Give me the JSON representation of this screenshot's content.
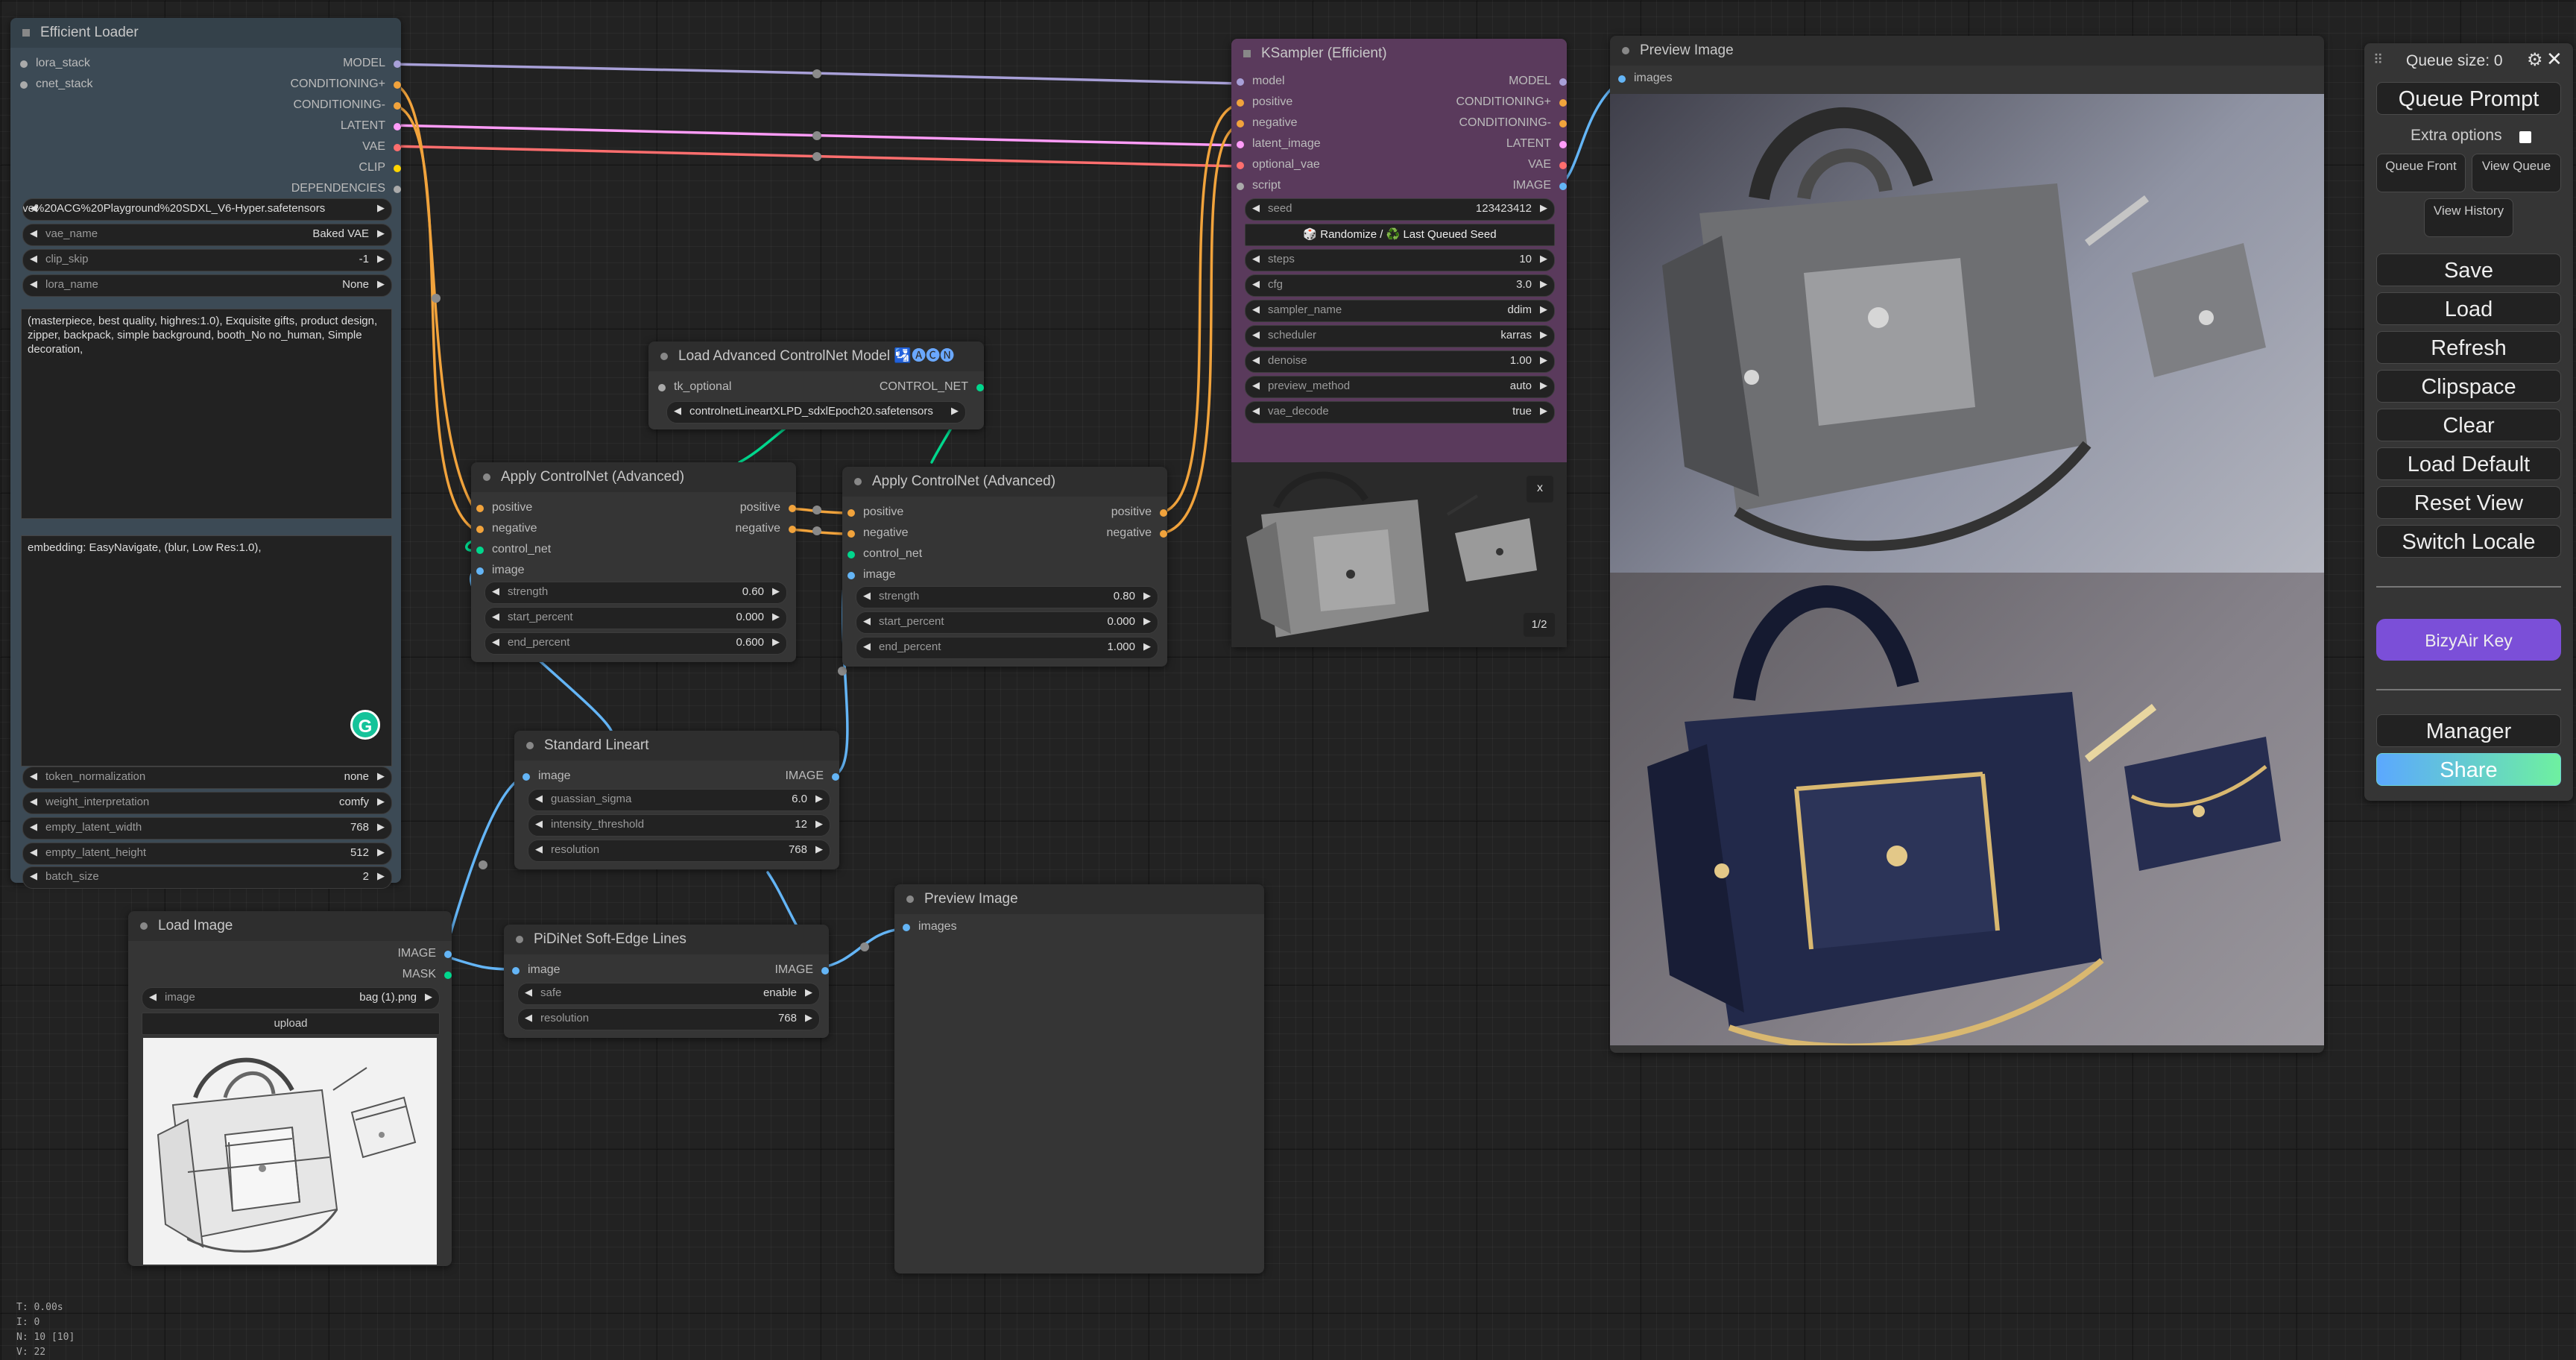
{
  "colors": {
    "model": "#a8a0d8",
    "conditioning": "#f1a33c",
    "latent": "#ff9cf9",
    "vae": "#ff6e6e",
    "clip": "#ffd500",
    "image": "#64b5f6",
    "control_net": "#00d78d",
    "default": "#aaaaaa",
    "purple_node": "#5a3a5c",
    "efficient_loader": "#3c4a55",
    "accent": "#7b4fd8"
  },
  "efficient_loader": {
    "title": "Efficient Loader",
    "inputs": [
      "lora_stack",
      "cnet_stack"
    ],
    "outputs": [
      "MODEL",
      "CONDITIONING+",
      "CONDITIONING-",
      "LATENT",
      "VAE",
      "CLIP",
      "DEPENDENCIES"
    ],
    "ckpt_name": "usive%20ACG%20Playground%20SDXL_V6-Hyper.safetensors",
    "widgets1": [
      {
        "label": "vae_name",
        "value": "Baked VAE"
      },
      {
        "label": "clip_skip",
        "value": "-1"
      },
      {
        "label": "lora_name",
        "value": "None"
      }
    ],
    "positive_prompt": "(masterpiece, best quality, highres:1.0), Exquisite gifts, product design, zipper, backpack, simple background, booth_No no_human, Simple decoration,",
    "negative_prompt": "embedding: EasyNavigate, (blur, Low Res:1.0),",
    "widgets2": [
      {
        "label": "token_normalization",
        "value": "none"
      },
      {
        "label": "weight_interpretation",
        "value": "comfy"
      },
      {
        "label": "empty_latent_width",
        "value": "768"
      },
      {
        "label": "empty_latent_height",
        "value": "512"
      },
      {
        "label": "batch_size",
        "value": "2"
      }
    ]
  },
  "ksampler": {
    "title": "KSampler (Efficient)",
    "inputs": [
      "model",
      "positive",
      "negative",
      "latent_image",
      "optional_vae",
      "script"
    ],
    "outputs": [
      "MODEL",
      "CONDITIONING+",
      "CONDITIONING-",
      "LATENT",
      "VAE",
      "IMAGE"
    ],
    "seed_label": "seed",
    "seed_value": "123423412",
    "randomize_button": "🎲 Randomize / ♻️ Last Queued Seed",
    "widgets": [
      {
        "label": "steps",
        "value": "10"
      },
      {
        "label": "cfg",
        "value": "3.0"
      },
      {
        "label": "sampler_name",
        "value": "ddim"
      },
      {
        "label": "scheduler",
        "value": "karras"
      },
      {
        "label": "denoise",
        "value": "1.00"
      },
      {
        "label": "preview_method",
        "value": "auto"
      },
      {
        "label": "vae_decode",
        "value": "true"
      }
    ],
    "preview_counter": "1/2",
    "preview_close": "x"
  },
  "preview_image_1": {
    "title": "Preview Image",
    "input": "images"
  },
  "preview_image_2": {
    "title": "Preview Image",
    "input": "images"
  },
  "controlnet_loader": {
    "title": "Load Advanced ControlNet Model",
    "badge": "🛂🅐🅒🅝",
    "input": "tk_optional",
    "output": "CONTROL_NET",
    "model_name": "controlnetLineartXLPD_sdxlEpoch20.safetensors"
  },
  "apply_cn_1": {
    "title": "Apply ControlNet (Advanced)",
    "inputs": [
      "positive",
      "negative",
      "control_net",
      "image"
    ],
    "outputs": [
      "positive",
      "negative"
    ],
    "widgets": [
      {
        "label": "strength",
        "value": "0.60"
      },
      {
        "label": "start_percent",
        "value": "0.000"
      },
      {
        "label": "end_percent",
        "value": "0.600"
      }
    ]
  },
  "apply_cn_2": {
    "title": "Apply ControlNet (Advanced)",
    "inputs": [
      "positive",
      "negative",
      "control_net",
      "image"
    ],
    "outputs": [
      "positive",
      "negative"
    ],
    "widgets": [
      {
        "label": "strength",
        "value": "0.80"
      },
      {
        "label": "start_percent",
        "value": "0.000"
      },
      {
        "label": "end_percent",
        "value": "1.000"
      }
    ]
  },
  "standard_lineart": {
    "title": "Standard Lineart",
    "input": "image",
    "output": "IMAGE",
    "widgets": [
      {
        "label": "guassian_sigma",
        "value": "6.0"
      },
      {
        "label": "intensity_threshold",
        "value": "12"
      },
      {
        "label": "resolution",
        "value": "768"
      }
    ]
  },
  "pidinet": {
    "title": "PiDiNet Soft-Edge Lines",
    "input": "image",
    "output": "IMAGE",
    "widgets": [
      {
        "label": "safe",
        "value": "enable"
      },
      {
        "label": "resolution",
        "value": "768"
      }
    ]
  },
  "load_image": {
    "title": "Load Image",
    "outputs": [
      "IMAGE",
      "MASK"
    ],
    "image_label": "image",
    "image_value": "bag (1).png",
    "upload_label": "upload"
  },
  "menu": {
    "queue_size": "Queue size: 0",
    "queue_prompt": "Queue Prompt",
    "extra_options": "Extra options",
    "queue_front": "Queue Front",
    "view_queue": "View Queue",
    "view_history": "View History",
    "buttons": [
      "Save",
      "Load",
      "Refresh",
      "Clipspace",
      "Clear",
      "Load Default",
      "Reset View",
      "Switch Locale"
    ],
    "bizyair_key": "BizyAir Key",
    "manager": "Manager",
    "share": "Share"
  },
  "stats": [
    "T: 0.00s",
    "I: 0",
    "N: 10 [10]",
    "V: 22"
  ]
}
